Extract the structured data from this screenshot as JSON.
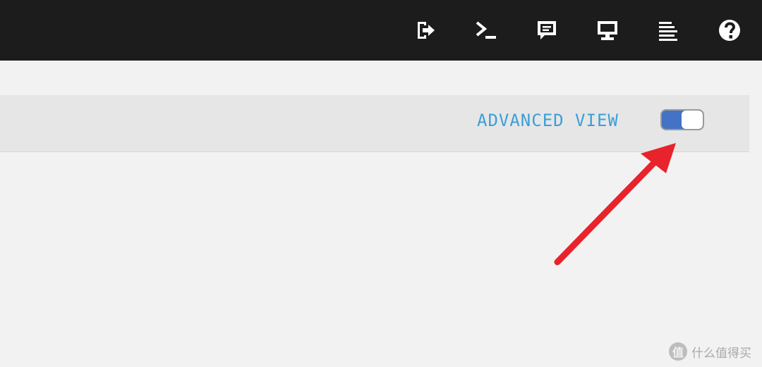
{
  "topbar": {
    "background": "#1c1c1c",
    "icons": [
      {
        "name": "logout-icon"
      },
      {
        "name": "terminal-icon"
      },
      {
        "name": "message-icon"
      },
      {
        "name": "monitor-icon"
      },
      {
        "name": "log-icon"
      },
      {
        "name": "help-icon"
      }
    ]
  },
  "view_toggle": {
    "label": "ADVANCED VIEW",
    "state": "on",
    "accent": "#3b9fd8",
    "track_color": "#4472c4"
  },
  "annotation": {
    "arrow_color": "#e8232b",
    "points_to": "advanced-view-toggle"
  },
  "watermark": {
    "logo_text": "值",
    "text": "什么值得买"
  }
}
